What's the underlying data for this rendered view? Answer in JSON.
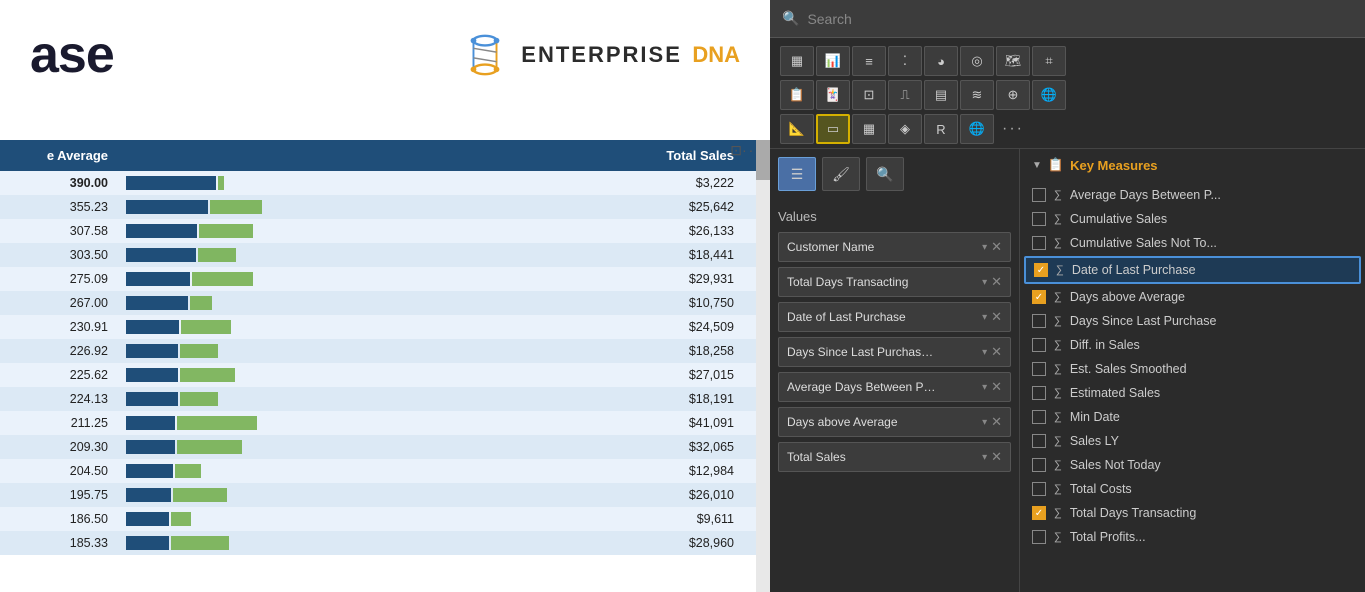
{
  "brand": {
    "title_partial": "ase",
    "enterprise": "ENTERPRISE",
    "dna": "DNA"
  },
  "table": {
    "headers": [
      "e Average",
      "Total Sales"
    ],
    "rows": [
      {
        "avg": "390.00",
        "bar_avg_pct": 100,
        "bar_total_pct": 8,
        "sales": "$3,222"
      },
      {
        "avg": "355.23",
        "bar_avg_pct": 91,
        "bar_total_pct": 65,
        "sales": "$25,642"
      },
      {
        "avg": "307.58",
        "bar_avg_pct": 79,
        "bar_total_pct": 67,
        "sales": "$26,133"
      },
      {
        "avg": "303.50",
        "bar_avg_pct": 78,
        "bar_total_pct": 47,
        "sales": "$18,441"
      },
      {
        "avg": "275.09",
        "bar_avg_pct": 71,
        "bar_total_pct": 77,
        "sales": "$29,931"
      },
      {
        "avg": "267.00",
        "bar_avg_pct": 69,
        "bar_total_pct": 28,
        "sales": "$10,750"
      },
      {
        "avg": "230.91",
        "bar_avg_pct": 59,
        "bar_total_pct": 63,
        "sales": "$24,509"
      },
      {
        "avg": "226.92",
        "bar_avg_pct": 58,
        "bar_total_pct": 47,
        "sales": "$18,258"
      },
      {
        "avg": "225.62",
        "bar_avg_pct": 58,
        "bar_total_pct": 69,
        "sales": "$27,015"
      },
      {
        "avg": "224.13",
        "bar_avg_pct": 58,
        "bar_total_pct": 47,
        "sales": "$18,191"
      },
      {
        "avg": "211.25",
        "bar_avg_pct": 54,
        "bar_total_pct": 100,
        "sales": "$41,091"
      },
      {
        "avg": "209.30",
        "bar_avg_pct": 54,
        "bar_total_pct": 82,
        "sales": "$32,065"
      },
      {
        "avg": "204.50",
        "bar_avg_pct": 52,
        "bar_total_pct": 33,
        "sales": "$12,984"
      },
      {
        "avg": "195.75",
        "bar_avg_pct": 50,
        "bar_total_pct": 67,
        "sales": "$26,010"
      },
      {
        "avg": "186.50",
        "bar_avg_pct": 48,
        "bar_total_pct": 25,
        "sales": "$9,611"
      },
      {
        "avg": "185.33",
        "bar_avg_pct": 48,
        "bar_total_pct": 72,
        "sales": "$28,960"
      }
    ]
  },
  "toolbar": {
    "icons": [
      {
        "name": "bar-chart",
        "symbol": "▦"
      },
      {
        "name": "line-chart",
        "symbol": "📈"
      },
      {
        "name": "area-chart",
        "symbol": "◿"
      },
      {
        "name": "scatter-plot",
        "symbol": "⁚"
      },
      {
        "name": "pie-chart",
        "symbol": "◕"
      },
      {
        "name": "donut-chart",
        "symbol": "◎"
      },
      {
        "name": "treemap",
        "symbol": "▤"
      },
      {
        "name": "map-chart",
        "symbol": "🌐"
      },
      {
        "name": "table-icon",
        "symbol": "⊞"
      },
      {
        "name": "matrix-icon",
        "symbol": "▦"
      },
      {
        "name": "card-icon",
        "symbol": "▭"
      },
      {
        "name": "kpi-icon",
        "symbol": "⟨K⟩"
      },
      {
        "name": "gauge-icon",
        "symbol": "◑"
      },
      {
        "name": "funnel-icon",
        "symbol": "⊿"
      },
      {
        "name": "ribbon-icon",
        "symbol": "≋"
      },
      {
        "name": "waterfall-icon",
        "symbol": "⎍"
      },
      {
        "name": "scatter-map",
        "symbol": "⊕"
      },
      {
        "name": "more-visuals",
        "symbol": "..."
      }
    ],
    "viz_tabs": [
      {
        "name": "fields-tab",
        "symbol": "☰",
        "active": true
      },
      {
        "name": "format-tab",
        "symbol": "🖌"
      },
      {
        "name": "analytics-tab",
        "symbol": "🔍"
      }
    ]
  },
  "values_panel": {
    "label": "Values",
    "fields": [
      {
        "name": "Customer Name",
        "label": "Customer Name"
      },
      {
        "name": "Total Days Transacting",
        "label": "Total Days Transacting"
      },
      {
        "name": "Date of Last Purchase",
        "label": "Date of Last Purchase"
      },
      {
        "name": "Days Since Last Purchase",
        "label": "Days Since Last Purchas…"
      },
      {
        "name": "Average Days Between Purchases",
        "label": "Average Days Between P…"
      },
      {
        "name": "Days above Average",
        "label": "Days above Average"
      },
      {
        "name": "Total Sales",
        "label": "Total Sales"
      }
    ]
  },
  "fields_panel": {
    "section_title": "Key Measures",
    "fields": [
      {
        "name": "Average Days Between P",
        "label": "Average Days Between P...",
        "checked": false,
        "is_measure": true
      },
      {
        "name": "Cumulative Sales",
        "label": "Cumulative Sales",
        "checked": false,
        "is_measure": true
      },
      {
        "name": "Cumulative Sales Not To",
        "label": "Cumulative Sales Not To...",
        "checked": false,
        "is_measure": true
      },
      {
        "name": "Date of Last Purchase",
        "label": "Date of Last Purchase",
        "checked": true,
        "is_measure": true,
        "highlighted": true
      },
      {
        "name": "Days above Average",
        "label": "Days above Average",
        "checked": true,
        "is_measure": true
      },
      {
        "name": "Days Since Last Purchase",
        "label": "Days Since Last Purchase",
        "checked": false,
        "is_measure": true
      },
      {
        "name": "Diff in Sales",
        "label": "Diff. in Sales",
        "checked": false,
        "is_measure": true
      },
      {
        "name": "Est Sales Smoothed",
        "label": "Est. Sales Smoothed",
        "checked": false,
        "is_measure": true
      },
      {
        "name": "Estimated Sales",
        "label": "Estimated Sales",
        "checked": false,
        "is_measure": true
      },
      {
        "name": "Min Date",
        "label": "Min Date",
        "checked": false,
        "is_measure": true
      },
      {
        "name": "Sales LY",
        "label": "Sales LY",
        "checked": false,
        "is_measure": true
      },
      {
        "name": "Sales Not Today",
        "label": "Sales Not Today",
        "checked": false,
        "is_measure": true
      },
      {
        "name": "Total Costs",
        "label": "Total Costs",
        "checked": false,
        "is_measure": true
      },
      {
        "name": "Total Days Transacting",
        "label": "Total Days Transacting",
        "checked": true,
        "is_measure": true
      },
      {
        "name": "Total Profits",
        "label": "Total Profits...",
        "checked": false,
        "is_measure": true
      }
    ]
  },
  "search": {
    "placeholder": "Search"
  }
}
